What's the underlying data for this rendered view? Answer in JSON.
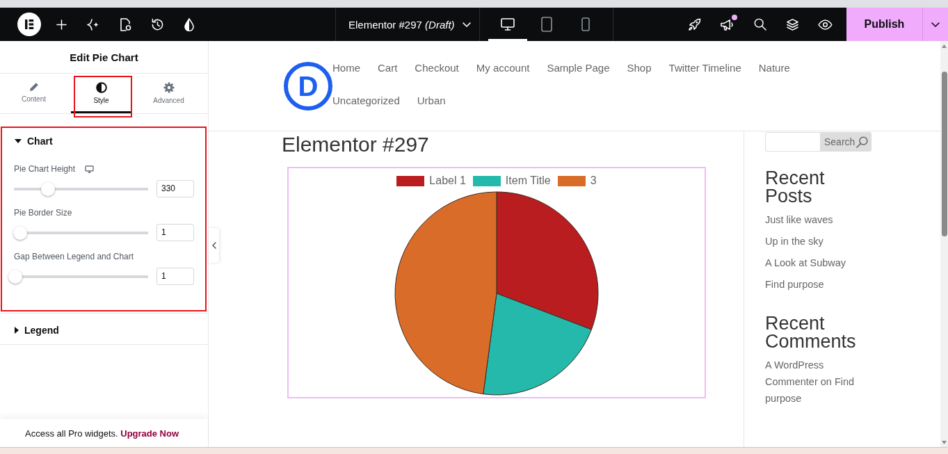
{
  "topbar": {
    "document_title": "Elementor #297 *(Draft)*",
    "devices": [
      {
        "kind": "desktop",
        "selected": true
      },
      {
        "kind": "tablet",
        "selected": false
      },
      {
        "kind": "mobile",
        "selected": false
      }
    ],
    "announcements_unread": true,
    "publish": "Publish"
  },
  "panel": {
    "title": "Edit Pie Chart",
    "tabs": [
      {
        "kind": "content",
        "label": "Content",
        "selected": false,
        "highlighted": false
      },
      {
        "kind": "style",
        "label": "Style",
        "selected": true,
        "highlighted": true
      },
      {
        "kind": "advanced",
        "label": "Advanced",
        "selected": false,
        "highlighted": false
      }
    ],
    "sections": [
      {
        "title": "Chart",
        "expanded": true,
        "highlighted": true,
        "controls": [
          {
            "label": "Pie Chart Height",
            "responsive": true,
            "level": 0.26,
            "value": "330"
          },
          {
            "label": "Pie Border Size",
            "responsive": false,
            "level": 0.04,
            "value": "1"
          },
          {
            "label": "Gap Between Legend and Chart",
            "responsive": false,
            "level": 0,
            "value": "1"
          }
        ]
      },
      {
        "title": "Legend",
        "expanded": false,
        "highlighted": false
      }
    ],
    "promo": {
      "text": "Access all Pro widgets.",
      "link": "Upgrade Now"
    }
  },
  "site": {
    "logo": "D",
    "nav": [
      "Home",
      "Cart",
      "Checkout",
      "My account",
      "Sample Page",
      "Shop",
      "Twitter Timeline",
      "Nature",
      "Uncategorized",
      "Urban"
    ],
    "page_title": "Elementor #297",
    "chart": {
      "legend": [
        {
          "label": "Label 1",
          "color": "#b91d1f"
        },
        {
          "label": "Item Title",
          "color": "#24b9aa"
        },
        {
          "label": "3",
          "color": "#da6c29"
        }
      ]
    },
    "sidebar": {
      "search_button": "Search",
      "widgets": [
        {
          "kind": "posts",
          "title": "Recent Posts",
          "links": [
            "Just like waves",
            "Up in the sky",
            "A Look at Subway",
            "Find purpose"
          ]
        },
        {
          "kind": "comments",
          "title": "Recent Comments",
          "links": [
            "A WordPress Commenter on Find purpose"
          ]
        }
      ]
    }
  }
}
